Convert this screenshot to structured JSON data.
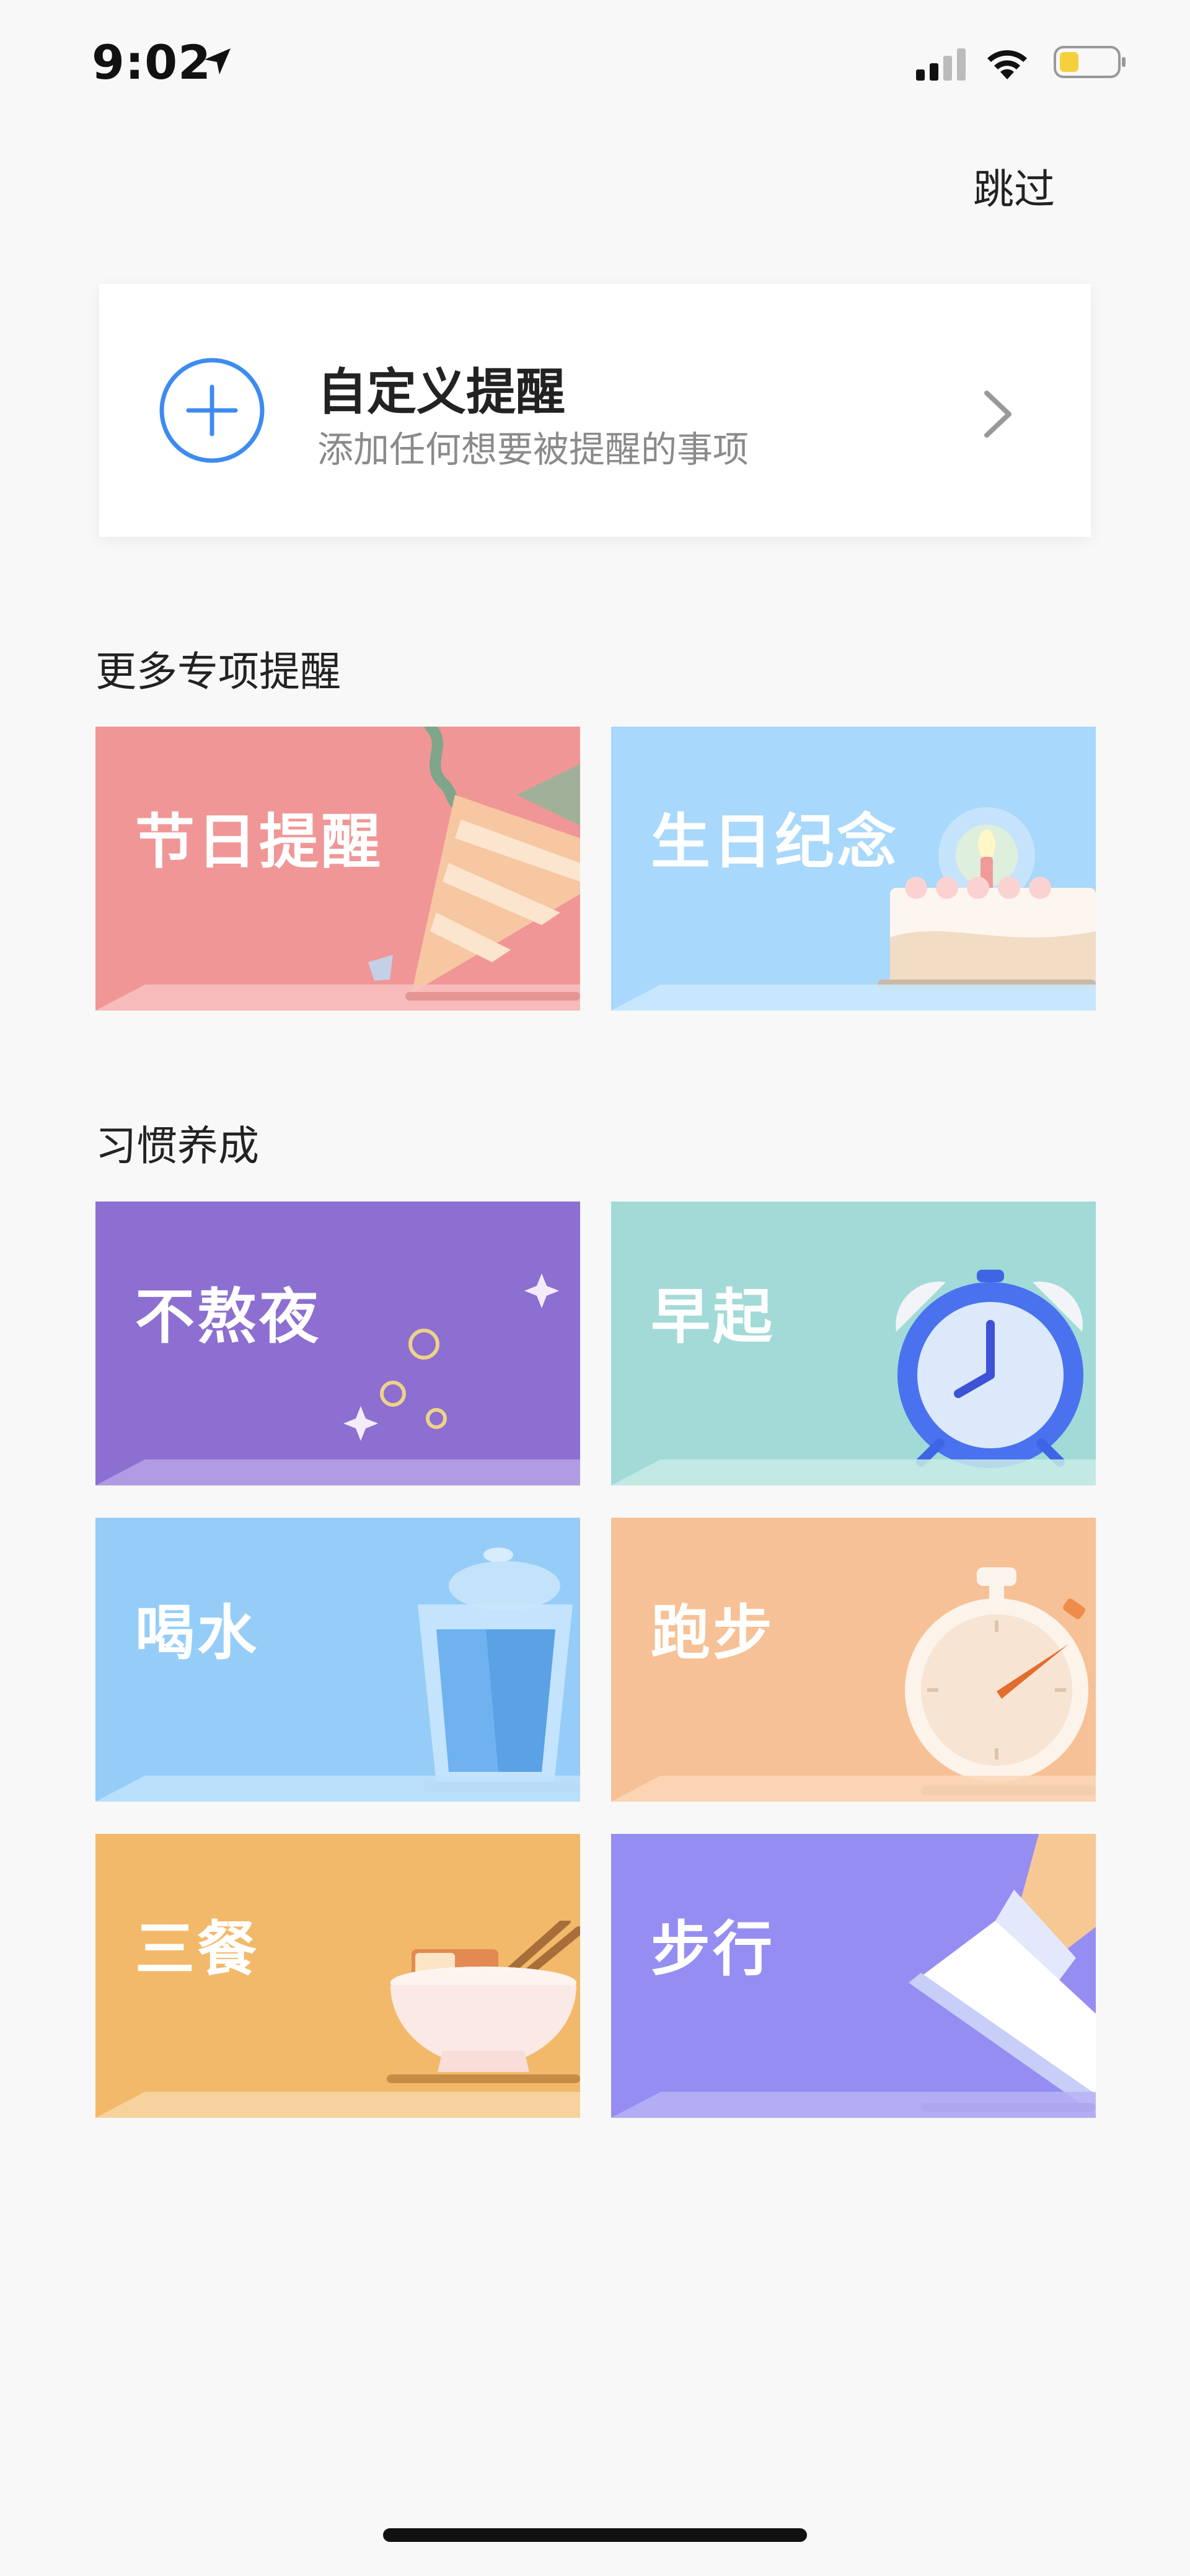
{
  "status_bar": {
    "time": "9:02",
    "battery_color": "#f5d03a"
  },
  "skip_label": "跳过",
  "custom_reminder": {
    "title": "自定义提醒",
    "subtitle": "添加任何想要被提醒的事项",
    "accent": "#3d8bf0"
  },
  "special_section": {
    "title": "更多专项提醒",
    "tiles": [
      {
        "label": "节日提醒",
        "color": "#f09696",
        "icon": "party-popper-icon"
      },
      {
        "label": "生日纪念",
        "color": "#a8d8fb",
        "icon": "birthday-cake-icon"
      }
    ]
  },
  "habit_section": {
    "title": "习惯养成",
    "tiles": [
      {
        "label": "不熬夜",
        "color": "#8c6fd1",
        "icon": "moon-icon"
      },
      {
        "label": "早起",
        "color": "#a2dad7",
        "icon": "alarm-clock-icon"
      },
      {
        "label": "喝水",
        "color": "#95cdf8",
        "icon": "water-glass-icon"
      },
      {
        "label": "跑步",
        "color": "#f6c196",
        "icon": "stopwatch-icon"
      },
      {
        "label": "三餐",
        "color": "#f3b96a",
        "icon": "rice-bowl-icon"
      },
      {
        "label": "步行",
        "color": "#968df2",
        "icon": "sneaker-icon"
      }
    ]
  }
}
